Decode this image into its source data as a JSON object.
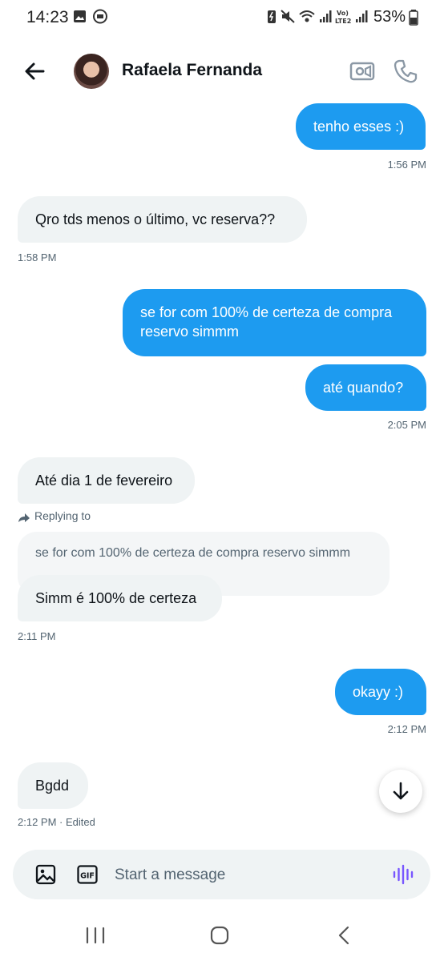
{
  "status_bar": {
    "time": "14:23",
    "battery": "53%"
  },
  "header": {
    "contact_name": "Rafaela Fernanda"
  },
  "messages": [
    {
      "text": "tenho esses :)",
      "time": "1:56 PM"
    },
    {
      "text": "Qro tds menos o último, vc reserva??",
      "time": "1:58 PM"
    },
    {
      "text": "se for com 100% de certeza de compra reservo simmm"
    },
    {
      "text": "até quando?",
      "time": "2:05 PM"
    },
    {
      "text": "Até dia 1 de fevereiro"
    },
    {
      "reply_label": "Replying to",
      "quoted_text": "se for com 100% de certeza de compra reservo simmm",
      "text": "Simm é 100% de certeza",
      "time": "2:11 PM"
    },
    {
      "text": "okayy :)",
      "time": "2:12 PM"
    },
    {
      "text": "Bgdd",
      "time": "2:12 PM · Edited"
    }
  ],
  "composer": {
    "placeholder": "Start a message",
    "value": ""
  },
  "icons": [
    "back-arrow-icon",
    "video-call-icon",
    "phone-call-icon",
    "image-icon",
    "gif-icon",
    "voice-message-icon",
    "arrow-down-icon",
    "recents-icon",
    "home-icon",
    "nav-back-icon"
  ],
  "colors": {
    "accent": "#1d9bf0",
    "incoming_bubble": "#eff3f4",
    "voice_icon": "#7856ff"
  }
}
